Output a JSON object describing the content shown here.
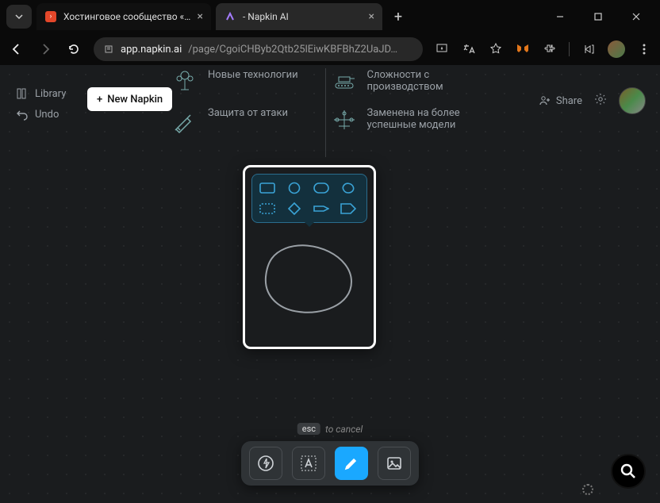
{
  "browser": {
    "tabs": [
      {
        "title": "Хостинговое сообщество «Tim",
        "favicon_bg": "#e4472a"
      },
      {
        "title": " - Napkin AI",
        "favicon_bg": "#6a4cff"
      }
    ],
    "url_domain": "app.napkin.ai",
    "url_path": "/page/CgoiCHByb2Qtb25lEiwKBFBhZ2UaJD…"
  },
  "left": {
    "library": "Library",
    "undo": "Undo"
  },
  "new_napkin": "New Napkin",
  "right": {
    "share": "Share"
  },
  "diagram": {
    "col1": [
      "Новые технологии",
      "Защита от атаки"
    ],
    "col2": [
      "Сложности с производством",
      "Заменена на более успешные модели"
    ]
  },
  "hint": {
    "key": "esc",
    "text": "to cancel"
  },
  "saving_label": ""
}
